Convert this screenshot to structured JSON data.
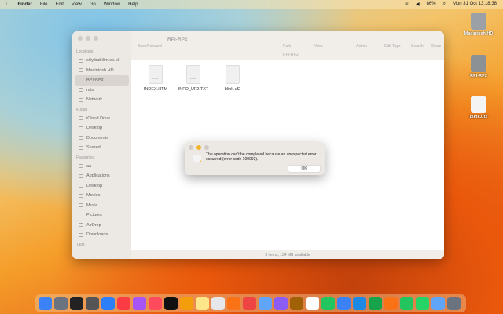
{
  "menubar": {
    "app": "Finder",
    "items": [
      "File",
      "Edit",
      "View",
      "Go",
      "Window",
      "Help"
    ],
    "battery": "86%",
    "clock": "Mon 31 Oct  13:18:38"
  },
  "desktop": [
    {
      "label": "Macintosh HD",
      "color": "#9aa0a6"
    },
    {
      "label": "RPI-RP2",
      "color": "#8c9196"
    },
    {
      "label": "blink.uf2",
      "color": "#f4f4f4"
    }
  ],
  "finder": {
    "title": "RPI-RP2",
    "back_forward": "Back/Forward",
    "path_label": "Path",
    "view_label": "View",
    "action_label": "Action",
    "edit_tags_label": "Edit Tags",
    "search_label": "Search",
    "share_label": "Share",
    "pathbar": "RPI-RP2",
    "sidebar": [
      {
        "section": "Locations",
        "items": [
          "silly.babilim.co.uk",
          "Macintosh HD",
          "RPI-RP2",
          "rats",
          "Network"
        ],
        "selected": "RPI-RP2"
      },
      {
        "section": "iCloud",
        "items": [
          "iCloud Drive",
          "Desktop",
          "Documents",
          "Shared"
        ]
      },
      {
        "section": "Favourites",
        "items": [
          "aa",
          "Applications",
          "Desktop",
          "Movies",
          "Music",
          "Pictures",
          "AirDrop",
          "Downloads"
        ]
      },
      {
        "section": "Tags",
        "items": []
      }
    ],
    "files": [
      {
        "name": "INDEX.HTM",
        "badge": "HTML"
      },
      {
        "name": "INFO_UF2.TXT",
        "badge": "TEXT"
      },
      {
        "name": "blink.uf2",
        "badge": ""
      }
    ],
    "status": "3 items, 134 MB available"
  },
  "dialog": {
    "message": "The operation can't be completed because an unexpected error occurred (error code 100093).",
    "ok": "OK"
  },
  "dock": [
    "#3b82f6",
    "#6b7280",
    "#222222",
    "#555555",
    "#2d7ff9",
    "#fc3c44",
    "#a855f7",
    "#ff4b5c",
    "#111111",
    "#f59e0b",
    "#fde68a",
    "#e5e7eb",
    "#f97316",
    "#ef4444",
    "#60a5fa",
    "#8b5cf6",
    "#a16207",
    "#ffffff",
    "#22c55e",
    "#3b82f6",
    "#1e88e5",
    "#16a34a",
    "#f97316",
    "#22c55e",
    "#25d366",
    "#60a5fa",
    "#6b7280"
  ]
}
